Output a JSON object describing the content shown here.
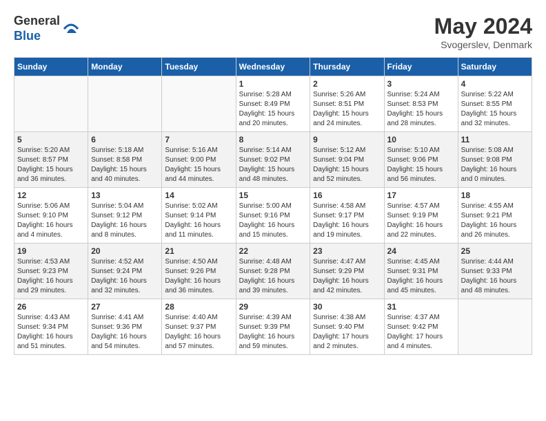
{
  "header": {
    "logo_general": "General",
    "logo_blue": "Blue",
    "month_year": "May 2024",
    "location": "Svogerslev, Denmark"
  },
  "weekdays": [
    "Sunday",
    "Monday",
    "Tuesday",
    "Wednesday",
    "Thursday",
    "Friday",
    "Saturday"
  ],
  "weeks": [
    [
      {
        "day": "",
        "info": ""
      },
      {
        "day": "",
        "info": ""
      },
      {
        "day": "",
        "info": ""
      },
      {
        "day": "1",
        "info": "Sunrise: 5:28 AM\nSunset: 8:49 PM\nDaylight: 15 hours\nand 20 minutes."
      },
      {
        "day": "2",
        "info": "Sunrise: 5:26 AM\nSunset: 8:51 PM\nDaylight: 15 hours\nand 24 minutes."
      },
      {
        "day": "3",
        "info": "Sunrise: 5:24 AM\nSunset: 8:53 PM\nDaylight: 15 hours\nand 28 minutes."
      },
      {
        "day": "4",
        "info": "Sunrise: 5:22 AM\nSunset: 8:55 PM\nDaylight: 15 hours\nand 32 minutes."
      }
    ],
    [
      {
        "day": "5",
        "info": "Sunrise: 5:20 AM\nSunset: 8:57 PM\nDaylight: 15 hours\nand 36 minutes."
      },
      {
        "day": "6",
        "info": "Sunrise: 5:18 AM\nSunset: 8:58 PM\nDaylight: 15 hours\nand 40 minutes."
      },
      {
        "day": "7",
        "info": "Sunrise: 5:16 AM\nSunset: 9:00 PM\nDaylight: 15 hours\nand 44 minutes."
      },
      {
        "day": "8",
        "info": "Sunrise: 5:14 AM\nSunset: 9:02 PM\nDaylight: 15 hours\nand 48 minutes."
      },
      {
        "day": "9",
        "info": "Sunrise: 5:12 AM\nSunset: 9:04 PM\nDaylight: 15 hours\nand 52 minutes."
      },
      {
        "day": "10",
        "info": "Sunrise: 5:10 AM\nSunset: 9:06 PM\nDaylight: 15 hours\nand 56 minutes."
      },
      {
        "day": "11",
        "info": "Sunrise: 5:08 AM\nSunset: 9:08 PM\nDaylight: 16 hours\nand 0 minutes."
      }
    ],
    [
      {
        "day": "12",
        "info": "Sunrise: 5:06 AM\nSunset: 9:10 PM\nDaylight: 16 hours\nand 4 minutes."
      },
      {
        "day": "13",
        "info": "Sunrise: 5:04 AM\nSunset: 9:12 PM\nDaylight: 16 hours\nand 8 minutes."
      },
      {
        "day": "14",
        "info": "Sunrise: 5:02 AM\nSunset: 9:14 PM\nDaylight: 16 hours\nand 11 minutes."
      },
      {
        "day": "15",
        "info": "Sunrise: 5:00 AM\nSunset: 9:16 PM\nDaylight: 16 hours\nand 15 minutes."
      },
      {
        "day": "16",
        "info": "Sunrise: 4:58 AM\nSunset: 9:17 PM\nDaylight: 16 hours\nand 19 minutes."
      },
      {
        "day": "17",
        "info": "Sunrise: 4:57 AM\nSunset: 9:19 PM\nDaylight: 16 hours\nand 22 minutes."
      },
      {
        "day": "18",
        "info": "Sunrise: 4:55 AM\nSunset: 9:21 PM\nDaylight: 16 hours\nand 26 minutes."
      }
    ],
    [
      {
        "day": "19",
        "info": "Sunrise: 4:53 AM\nSunset: 9:23 PM\nDaylight: 16 hours\nand 29 minutes."
      },
      {
        "day": "20",
        "info": "Sunrise: 4:52 AM\nSunset: 9:24 PM\nDaylight: 16 hours\nand 32 minutes."
      },
      {
        "day": "21",
        "info": "Sunrise: 4:50 AM\nSunset: 9:26 PM\nDaylight: 16 hours\nand 36 minutes."
      },
      {
        "day": "22",
        "info": "Sunrise: 4:48 AM\nSunset: 9:28 PM\nDaylight: 16 hours\nand 39 minutes."
      },
      {
        "day": "23",
        "info": "Sunrise: 4:47 AM\nSunset: 9:29 PM\nDaylight: 16 hours\nand 42 minutes."
      },
      {
        "day": "24",
        "info": "Sunrise: 4:45 AM\nSunset: 9:31 PM\nDaylight: 16 hours\nand 45 minutes."
      },
      {
        "day": "25",
        "info": "Sunrise: 4:44 AM\nSunset: 9:33 PM\nDaylight: 16 hours\nand 48 minutes."
      }
    ],
    [
      {
        "day": "26",
        "info": "Sunrise: 4:43 AM\nSunset: 9:34 PM\nDaylight: 16 hours\nand 51 minutes."
      },
      {
        "day": "27",
        "info": "Sunrise: 4:41 AM\nSunset: 9:36 PM\nDaylight: 16 hours\nand 54 minutes."
      },
      {
        "day": "28",
        "info": "Sunrise: 4:40 AM\nSunset: 9:37 PM\nDaylight: 16 hours\nand 57 minutes."
      },
      {
        "day": "29",
        "info": "Sunrise: 4:39 AM\nSunset: 9:39 PM\nDaylight: 16 hours\nand 59 minutes."
      },
      {
        "day": "30",
        "info": "Sunrise: 4:38 AM\nSunset: 9:40 PM\nDaylight: 17 hours\nand 2 minutes."
      },
      {
        "day": "31",
        "info": "Sunrise: 4:37 AM\nSunset: 9:42 PM\nDaylight: 17 hours\nand 4 minutes."
      },
      {
        "day": "",
        "info": ""
      }
    ]
  ]
}
